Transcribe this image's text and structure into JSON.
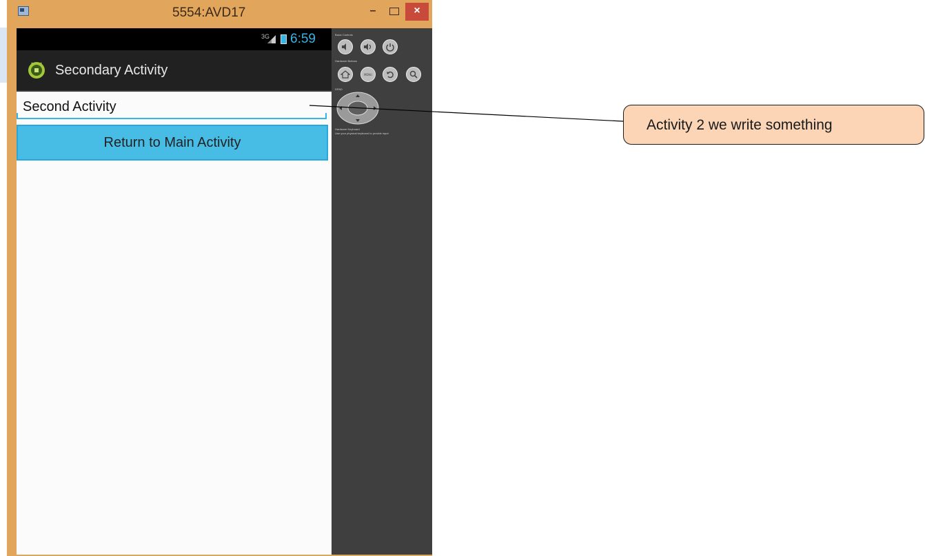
{
  "window": {
    "title": "5554:AVD17",
    "minimize_label": "–",
    "close_label": "×"
  },
  "status_bar": {
    "network": "3G",
    "time": "6:59"
  },
  "action_bar": {
    "title": "Secondary Activity"
  },
  "main": {
    "edit_text_value": "Second Activity",
    "return_button_label": "Return to Main Activity"
  },
  "controls_panel": {
    "basic_controls_label": "Basic Controls",
    "hardware_buttons_label": "Hardware Buttons",
    "dpad_label": "DPAD",
    "keyboard_label": "Hardware Keyboard",
    "keyboard_hint": "Use your physical keyboard to provide input",
    "menu_label": "MENU"
  },
  "callout": {
    "text": "Activity 2 we write something"
  },
  "colors": {
    "window_frame": "#e2a55c",
    "accent": "#33b5e5",
    "button": "#47bde6",
    "callout_fill": "#fbd5b5",
    "close_button": "#c84a3a"
  }
}
